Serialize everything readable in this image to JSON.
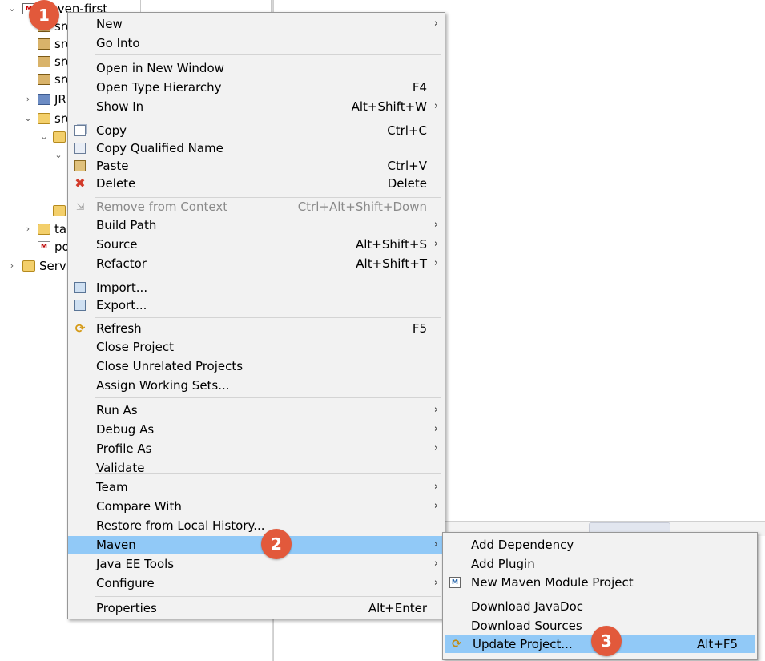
{
  "tree": {
    "rows": [
      {
        "label": "maven-first",
        "twisty": "expanded",
        "icon": "maven-project-icon"
      },
      {
        "label": "src",
        "twisty": "",
        "icon": "package-folder-icon"
      },
      {
        "label": "src",
        "twisty": "",
        "icon": "package-folder-icon"
      },
      {
        "label": "src",
        "twisty": "",
        "icon": "package-folder-icon"
      },
      {
        "label": "src",
        "twisty": "",
        "icon": "package-folder-icon"
      },
      {
        "label": "JR",
        "twisty": "collapsed",
        "icon": "library-icon"
      },
      {
        "label": "src",
        "twisty": "expanded",
        "icon": "folder-icon"
      },
      {
        "label": "",
        "twisty": "expanded",
        "icon": "folder-icon"
      },
      {
        "label": "",
        "twisty": "expanded",
        "icon": ""
      },
      {
        "label": "",
        "twisty": "",
        "icon": "folder-icon"
      },
      {
        "label": "ta",
        "twisty": "collapsed",
        "icon": "folder-icon"
      },
      {
        "label": "po",
        "twisty": "",
        "icon": "pom-file-icon"
      },
      {
        "label": "Serv",
        "twisty": "collapsed",
        "icon": "folder-icon"
      }
    ]
  },
  "main_menu": {
    "items": [
      {
        "label": "New",
        "shortcut": "",
        "arrow": "›",
        "icon": ""
      },
      {
        "label": "Go Into",
        "shortcut": "",
        "arrow": "",
        "icon": ""
      },
      {
        "label": "Open in New Window",
        "shortcut": "",
        "arrow": "",
        "icon": ""
      },
      {
        "label": "Open Type Hierarchy",
        "shortcut": "F4",
        "arrow": "",
        "icon": ""
      },
      {
        "label": "Show In",
        "shortcut": "Alt+Shift+W",
        "arrow": "›",
        "icon": ""
      },
      {
        "label": "Copy",
        "shortcut": "Ctrl+C",
        "arrow": "",
        "icon": "copy-icon"
      },
      {
        "label": "Copy Qualified Name",
        "shortcut": "",
        "arrow": "",
        "icon": "copy-qualified-name-icon"
      },
      {
        "label": "Paste",
        "shortcut": "Ctrl+V",
        "arrow": "",
        "icon": "paste-icon"
      },
      {
        "label": "Delete",
        "shortcut": "Delete",
        "arrow": "",
        "icon": "delete-icon"
      },
      {
        "label": "Remove from Context",
        "shortcut": "Ctrl+Alt+Shift+Down",
        "arrow": "",
        "icon": "remove-context-icon",
        "disabled": true
      },
      {
        "label": "Build Path",
        "shortcut": "",
        "arrow": "›",
        "icon": ""
      },
      {
        "label": "Source",
        "shortcut": "Alt+Shift+S",
        "arrow": "›",
        "icon": ""
      },
      {
        "label": "Refactor",
        "shortcut": "Alt+Shift+T",
        "arrow": "›",
        "icon": ""
      },
      {
        "label": "Import...",
        "shortcut": "",
        "arrow": "",
        "icon": "import-icon"
      },
      {
        "label": "Export...",
        "shortcut": "",
        "arrow": "",
        "icon": "export-icon"
      },
      {
        "label": "Refresh",
        "shortcut": "F5",
        "arrow": "",
        "icon": "refresh-icon"
      },
      {
        "label": "Close Project",
        "shortcut": "",
        "arrow": "",
        "icon": ""
      },
      {
        "label": "Close Unrelated Projects",
        "shortcut": "",
        "arrow": "",
        "icon": ""
      },
      {
        "label": "Assign Working Sets...",
        "shortcut": "",
        "arrow": "",
        "icon": ""
      },
      {
        "label": "Run As",
        "shortcut": "",
        "arrow": "›",
        "icon": ""
      },
      {
        "label": "Debug As",
        "shortcut": "",
        "arrow": "›",
        "icon": ""
      },
      {
        "label": "Profile As",
        "shortcut": "",
        "arrow": "›",
        "icon": ""
      },
      {
        "label": "Validate",
        "shortcut": "",
        "arrow": "",
        "icon": ""
      },
      {
        "label": "Team",
        "shortcut": "",
        "arrow": "›",
        "icon": ""
      },
      {
        "label": "Compare With",
        "shortcut": "",
        "arrow": "›",
        "icon": ""
      },
      {
        "label": "Restore from Local History...",
        "shortcut": "",
        "arrow": "",
        "icon": ""
      },
      {
        "label": "Maven",
        "shortcut": "",
        "arrow": "›",
        "icon": "",
        "highlighted": true
      },
      {
        "label": "Java EE Tools",
        "shortcut": "",
        "arrow": "›",
        "icon": ""
      },
      {
        "label": "Configure",
        "shortcut": "",
        "arrow": "›",
        "icon": ""
      },
      {
        "label": "Properties",
        "shortcut": "Alt+Enter",
        "arrow": "",
        "icon": ""
      }
    ]
  },
  "maven_menu": {
    "items": [
      {
        "label": "Add Dependency",
        "shortcut": "",
        "icon": ""
      },
      {
        "label": "Add Plugin",
        "shortcut": "",
        "icon": ""
      },
      {
        "label": "New Maven Module Project",
        "shortcut": "",
        "icon": "maven-module-icon"
      },
      {
        "label": "Download JavaDoc",
        "shortcut": "",
        "icon": ""
      },
      {
        "label": "Download Sources",
        "shortcut": "",
        "icon": ""
      },
      {
        "label": "Update Project...",
        "shortcut": "Alt+F5",
        "icon": "update-project-icon",
        "highlighted": true
      }
    ]
  },
  "badges": {
    "step1": "1",
    "step2": "2",
    "step3": "3"
  },
  "colors": {
    "highlight": "#91c9f7",
    "badge": "#e2593b",
    "menu_bg": "#f2f2f2"
  }
}
